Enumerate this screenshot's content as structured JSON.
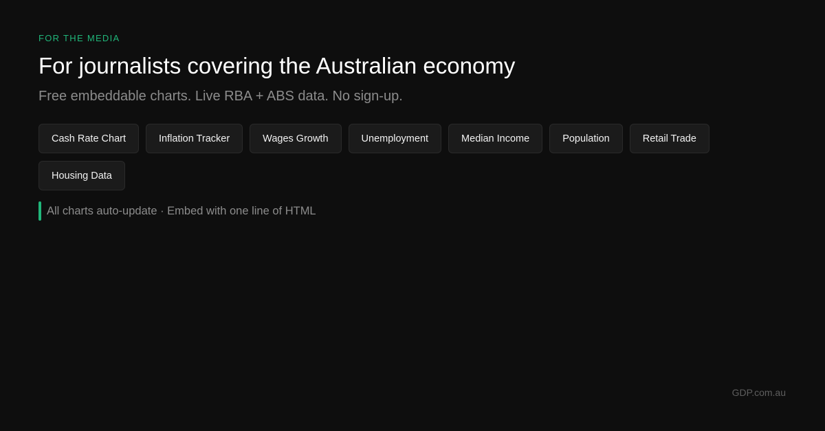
{
  "colors": {
    "background": "#0e0e0e",
    "accent": "#20b67a",
    "pill_background": "#1b1b1b",
    "muted_text": "#8c8c8c"
  },
  "hero": {
    "eyebrow": "FOR THE MEDIA",
    "headline": "For journalists covering the Australian economy",
    "subline": "Free embeddable charts. Live RBA + ABS data. No sign-up."
  },
  "chart_links": [
    {
      "label": "Cash Rate Chart"
    },
    {
      "label": "Inflation Tracker"
    },
    {
      "label": "Wages Growth"
    },
    {
      "label": "Unemployment"
    },
    {
      "label": "Median Income"
    },
    {
      "label": "Population"
    },
    {
      "label": "Retail Trade"
    },
    {
      "label": "Housing Data"
    }
  ],
  "note": {
    "text": "All charts auto-update · Embed with one line of HTML"
  },
  "footer": {
    "brand": "GDP.com.au"
  }
}
